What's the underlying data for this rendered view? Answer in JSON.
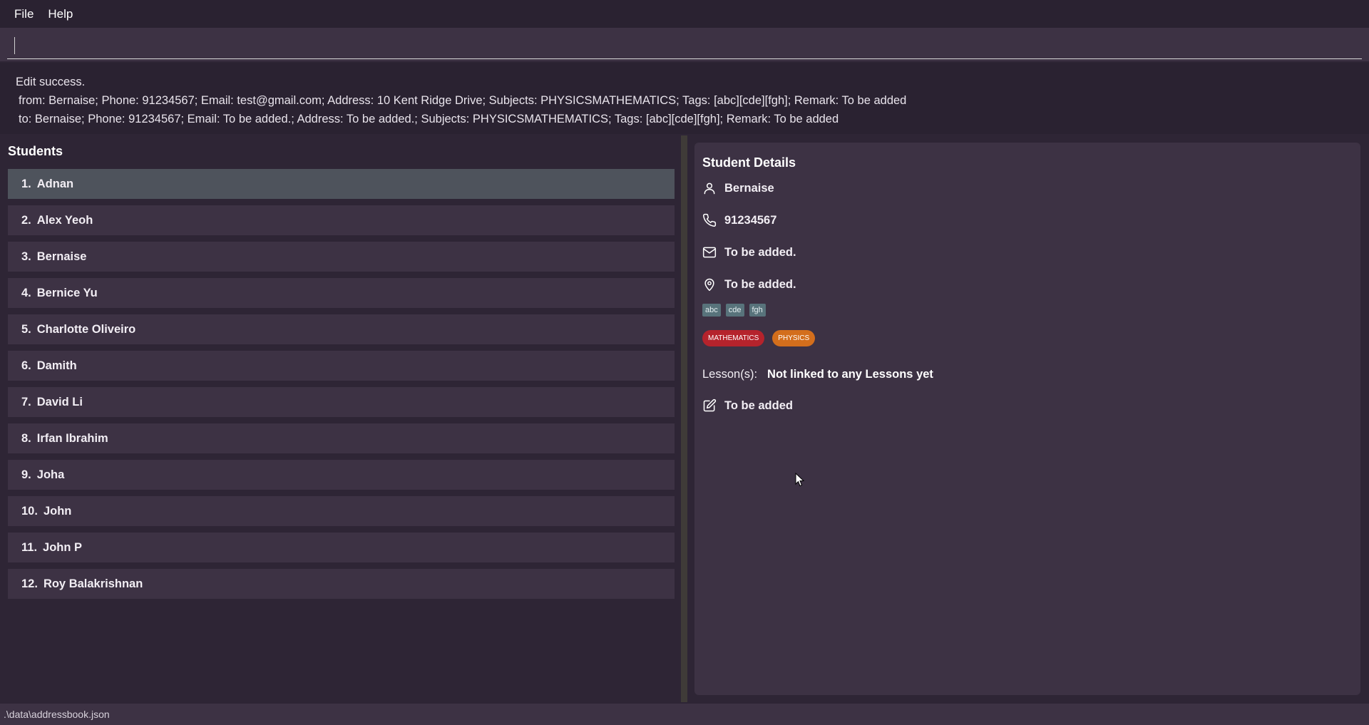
{
  "menu": {
    "file": "File",
    "help": "Help"
  },
  "command": {
    "value": "",
    "placeholder": ""
  },
  "result": {
    "line1": "Edit success.",
    "line2": "from: Bernaise; Phone: 91234567; Email: test@gmail.com; Address: 10 Kent Ridge Drive; Subjects: PHYSICSMATHEMATICS; Tags: [abc][cde][fgh]; Remark: To be added",
    "line3": "to: Bernaise; Phone: 91234567; Email: To be added.; Address: To be added.; Subjects: PHYSICSMATHEMATICS; Tags: [abc][cde][fgh]; Remark: To be added"
  },
  "students": {
    "title": "Students",
    "items": [
      {
        "index": "1.",
        "name": "Adnan"
      },
      {
        "index": "2.",
        "name": "Alex Yeoh"
      },
      {
        "index": "3.",
        "name": "Bernaise"
      },
      {
        "index": "4.",
        "name": "Bernice Yu"
      },
      {
        "index": "5.",
        "name": "Charlotte Oliveiro"
      },
      {
        "index": "6.",
        "name": "Damith"
      },
      {
        "index": "7.",
        "name": "David Li"
      },
      {
        "index": "8.",
        "name": "Irfan Ibrahim"
      },
      {
        "index": "9.",
        "name": "Joha"
      },
      {
        "index": "10.",
        "name": "John"
      },
      {
        "index": "11.",
        "name": "John P"
      },
      {
        "index": "12.",
        "name": "Roy Balakrishnan"
      }
    ],
    "selected_index": 0
  },
  "details": {
    "title": "Student Details",
    "name": "Bernaise",
    "phone": "91234567",
    "email": "To be added.",
    "address": "To be added.",
    "tags": [
      "abc",
      "cde",
      "fgh"
    ],
    "subjects": [
      {
        "label": "MATHEMATICS",
        "color": "#b5232c"
      },
      {
        "label": "PHYSICS",
        "color": "#d36e1c"
      }
    ],
    "lesson_label": "Lesson(s):",
    "lesson_value": "Not linked to any Lessons yet",
    "remark": "To be added"
  },
  "status_bar": {
    "path": ".\\data\\addressbook.json"
  },
  "icons": {
    "name": "person-icon",
    "phone": "phone-icon",
    "email": "mail-icon",
    "address": "location-pin-icon",
    "remark": "edit-icon"
  },
  "colors": {
    "background": "#2e2535",
    "panel": "#3d3244",
    "selected_row": "#4e535c",
    "tag": "#58737b"
  }
}
